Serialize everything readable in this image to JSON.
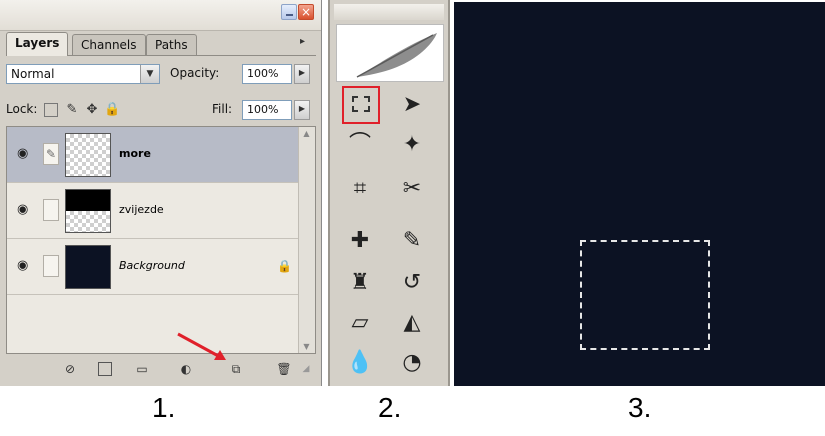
{
  "layers_panel": {
    "tabs": [
      "Layers",
      "Channels",
      "Paths"
    ],
    "blend_mode": "Normal",
    "opacity_label": "Opacity:",
    "opacity_value": "100%",
    "lock_label": "Lock:",
    "fill_label": "Fill:",
    "fill_value": "100%",
    "layers": [
      {
        "name": "more",
        "selected": true
      },
      {
        "name": "zvijezde",
        "selected": false
      },
      {
        "name": "Background",
        "selected": false,
        "locked": true
      }
    ],
    "bottom_icons": [
      "link-layers-icon",
      "layer-style-icon",
      "mask-icon",
      "adjustment-icon",
      "new-group-icon",
      "new-layer-icon",
      "trash-icon"
    ]
  },
  "tools_panel": {
    "selected_tool": "rectangular-marquee",
    "tools": [
      "rectangular-marquee",
      "move",
      "lasso",
      "magic-wand",
      "crop",
      "slice",
      "healing-brush",
      "brush",
      "clone-stamp",
      "history-brush",
      "eraser",
      "paint-bucket",
      "blur",
      "dodge"
    ]
  },
  "canvas": {
    "background_color": "#0c1223",
    "selection_style": "dashed-rectangle"
  },
  "steps": {
    "one": "1.",
    "two": "2.",
    "three": "3."
  },
  "accent_colors": {
    "highlight_red": "#e0202a",
    "selected_layer": "#b7bbc7"
  }
}
